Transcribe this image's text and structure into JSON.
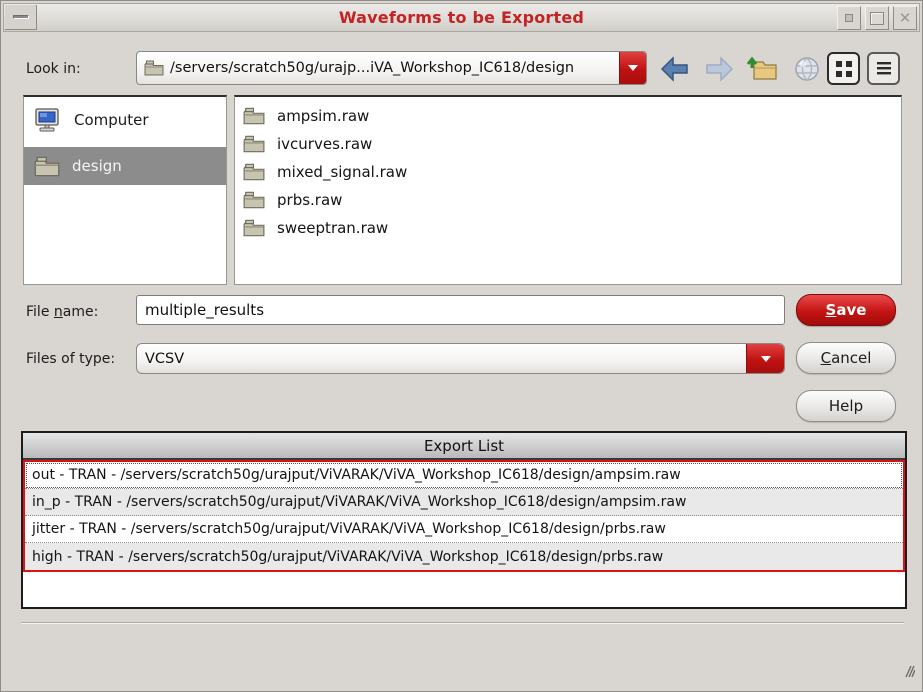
{
  "window": {
    "title": "Waveforms to be Exported"
  },
  "toolbar": {
    "look_in_label": "Look in:",
    "path_value": "/servers/scratch50g/urajp...iVA_Workshop_IC618/design"
  },
  "icons": {
    "menu": "dash",
    "minimize": "dot",
    "maximize": "square",
    "close_glyph": "✕",
    "dropdown": "▼",
    "back": "left-arrow-blue",
    "forward": "right-arrow-gray",
    "parent_dir": "folder-up-green-arrow",
    "new_folder": "globe-sphere",
    "icon_view": "grid-squares",
    "detail_view": "list-lines",
    "folder": "folder-khaki",
    "computer": "monitor-blue-screen",
    "resize": "diagonal-grip"
  },
  "sidebar": {
    "items": [
      {
        "label": "Computer",
        "selected": false
      },
      {
        "label": "design",
        "selected": true
      }
    ]
  },
  "file_list": {
    "items": [
      "ampsim.raw",
      "ivcurves.raw",
      "mixed_signal.raw",
      "prbs.raw",
      "sweeptran.raw"
    ]
  },
  "form": {
    "file_name_label": {
      "pre": "File ",
      "mn": "n",
      "post": "ame:"
    },
    "file_name_value": "multiple_results",
    "files_of_type_label": "Files of type:",
    "files_of_type_value": "VCSV",
    "save": {
      "mn": "S",
      "post": "ave"
    },
    "cancel": {
      "mn": "C",
      "post": "ancel"
    },
    "help": "Help"
  },
  "export_list": {
    "header": "Export List",
    "rows": [
      "out - TRAN - /servers/scratch50g/urajput/ViVARAK/ViVA_Workshop_IC618/design/ampsim.raw",
      "in_p - TRAN - /servers/scratch50g/urajput/ViVARAK/ViVA_Workshop_IC618/design/ampsim.raw",
      "jitter - TRAN - /servers/scratch50g/urajput/ViVARAK/ViVA_Workshop_IC618/design/prbs.raw",
      "high - TRAN - /servers/scratch50g/urajput/ViVARAK/ViVA_Workshop_IC618/design/prbs.raw"
    ]
  },
  "colors": {
    "accent_red": "#c41414",
    "title_red": "#c32323",
    "selection_gray": "#8c8c8c",
    "row_alt": "#e9e9e9",
    "selection_outline": "#e01111"
  }
}
